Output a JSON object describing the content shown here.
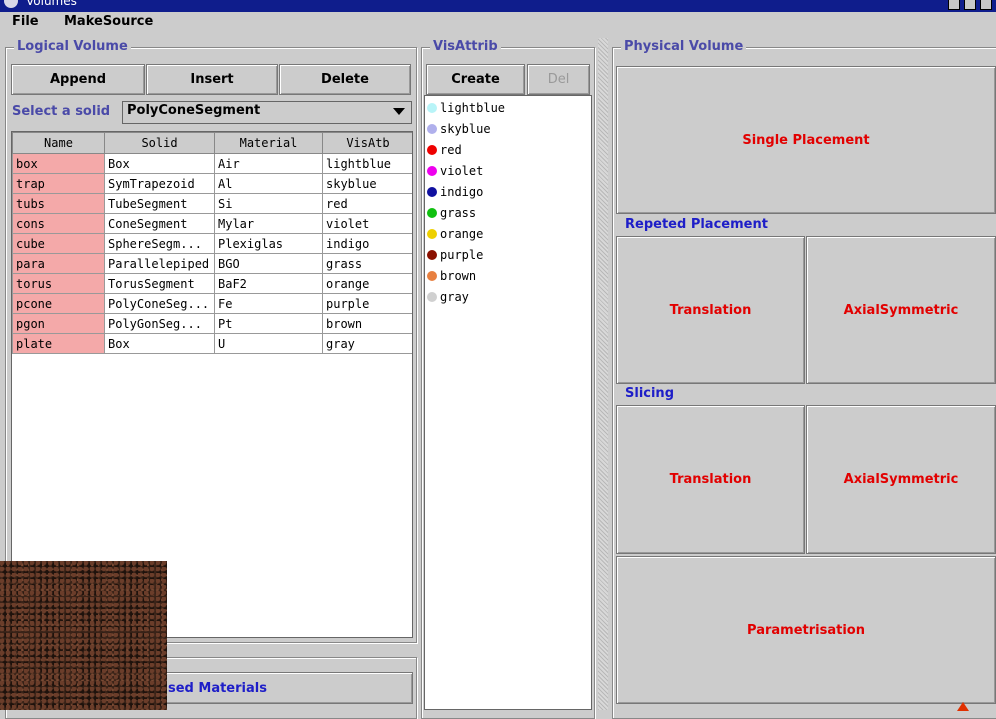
{
  "window": {
    "title": "Volumes"
  },
  "menu": {
    "items": [
      "File",
      "MakeSource"
    ]
  },
  "logical_volume": {
    "title": "Logical Volume",
    "buttons": {
      "append": "Append",
      "insert": "Insert",
      "delete": "Delete"
    },
    "solid_label": "Select a solid",
    "solid_value": "PolyConeSegment",
    "columns": [
      "Name",
      "Solid",
      "Material",
      "VisAtb"
    ],
    "rows": [
      [
        "box",
        "Box",
        "Air",
        "lightblue"
      ],
      [
        "trap",
        "SymTrapezoid",
        "Al",
        "skyblue"
      ],
      [
        "tubs",
        "TubeSegment",
        "Si",
        "red"
      ],
      [
        "cons",
        "ConeSegment",
        "Mylar",
        "violet"
      ],
      [
        "cube",
        "SphereSegm...",
        "Plexiglas",
        "indigo"
      ],
      [
        "para",
        "Parallelepiped",
        "BGO",
        "grass"
      ],
      [
        "torus",
        "TorusSegment",
        "BaF2",
        "orange"
      ],
      [
        "pcone",
        "PolyConeSeg...",
        "Fe",
        "purple"
      ],
      [
        "pgon",
        "PolyGonSeg...",
        "Pt",
        "brown"
      ],
      [
        "plate",
        "Box",
        "U",
        "gray"
      ]
    ],
    "used_materials_button": "sed Materials"
  },
  "vis_attrib": {
    "title": "VisAttrib",
    "create_label": "Create",
    "del_label": "Del",
    "items": [
      {
        "name": "lightblue",
        "color": "#b8f4f8"
      },
      {
        "name": "skyblue",
        "color": "#b0b0ec"
      },
      {
        "name": "red",
        "color": "#ee0000"
      },
      {
        "name": "violet",
        "color": "#ee00ee"
      },
      {
        "name": "indigo",
        "color": "#1010a0"
      },
      {
        "name": "grass",
        "color": "#10c010"
      },
      {
        "name": "orange",
        "color": "#eed000"
      },
      {
        "name": "purple",
        "color": "#8a1000"
      },
      {
        "name": "brown",
        "color": "#e88040"
      },
      {
        "name": "gray",
        "color": "#d0d0d0"
      }
    ]
  },
  "physical_volume": {
    "title": "Physical Volume",
    "single_placement": "Single Placement",
    "repeated_label": "Repeted Placement",
    "repeated": {
      "translation": "Translation",
      "axial": "AxialSymmetric"
    },
    "slicing_label": "Slicing",
    "slicing": {
      "translation": "Translation",
      "axial": "AxialSymmetric"
    },
    "parametrisation": "Parametrisation"
  }
}
